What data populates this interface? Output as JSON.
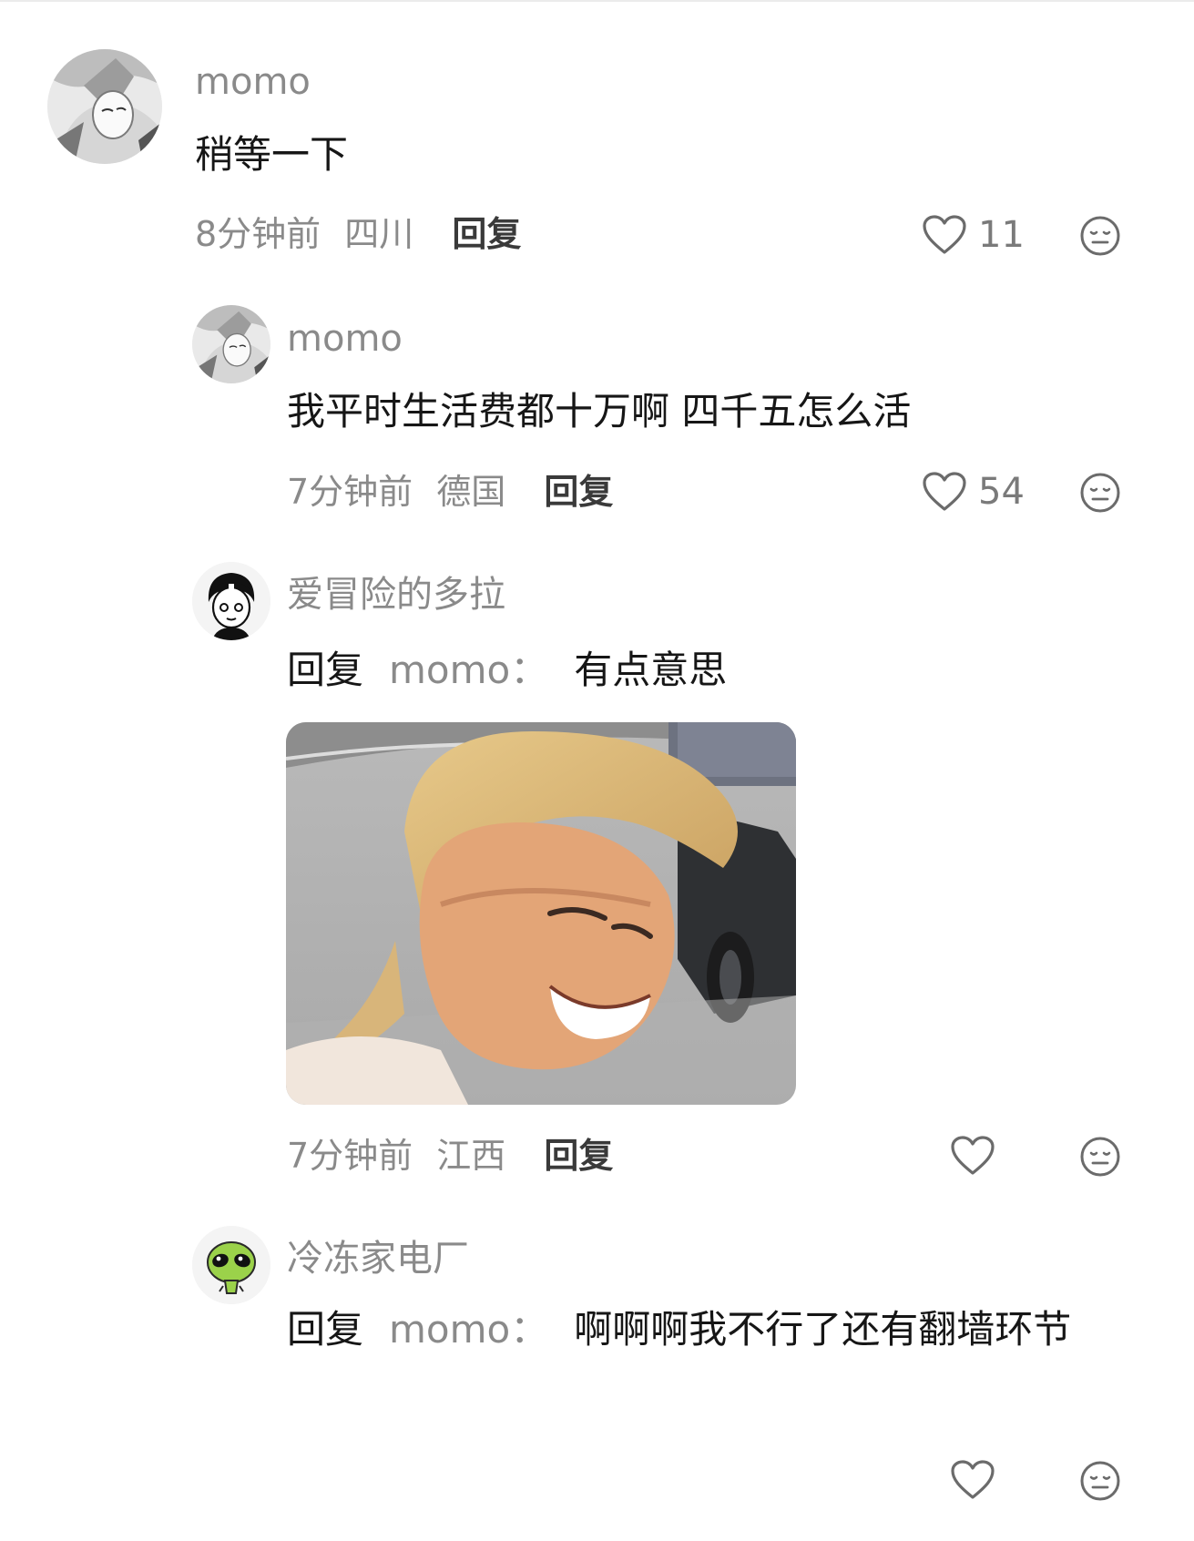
{
  "comments": [
    {
      "username": "momo",
      "text": "稍等一下",
      "time": "8分钟前",
      "location": "四川",
      "reply_label": "回复",
      "likes": "11"
    },
    {
      "username": "momo",
      "text": "我平时生活费都十万啊 四千五怎么活",
      "time": "7分钟前",
      "location": "德国",
      "reply_label": "回复",
      "likes": "54"
    },
    {
      "username": "爱冒险的多拉",
      "reply_prefix": "回复",
      "reply_to": "momo",
      "colon": "：",
      "text": "有点意思",
      "time": "7分钟前",
      "location": "江西",
      "reply_label": "回复",
      "likes": ""
    },
    {
      "username": "冷冻家电厂",
      "reply_prefix": "回复",
      "reply_to": "momo",
      "colon": "：",
      "text": "啊啊啊我不行了还有翻墙环节",
      "likes": ""
    }
  ],
  "icons": {
    "like": "heart-icon",
    "dislike": "meh-face-icon"
  },
  "colors": {
    "username": "#8a8a8a",
    "content": "#161616",
    "meta": "#8a8a8a"
  }
}
